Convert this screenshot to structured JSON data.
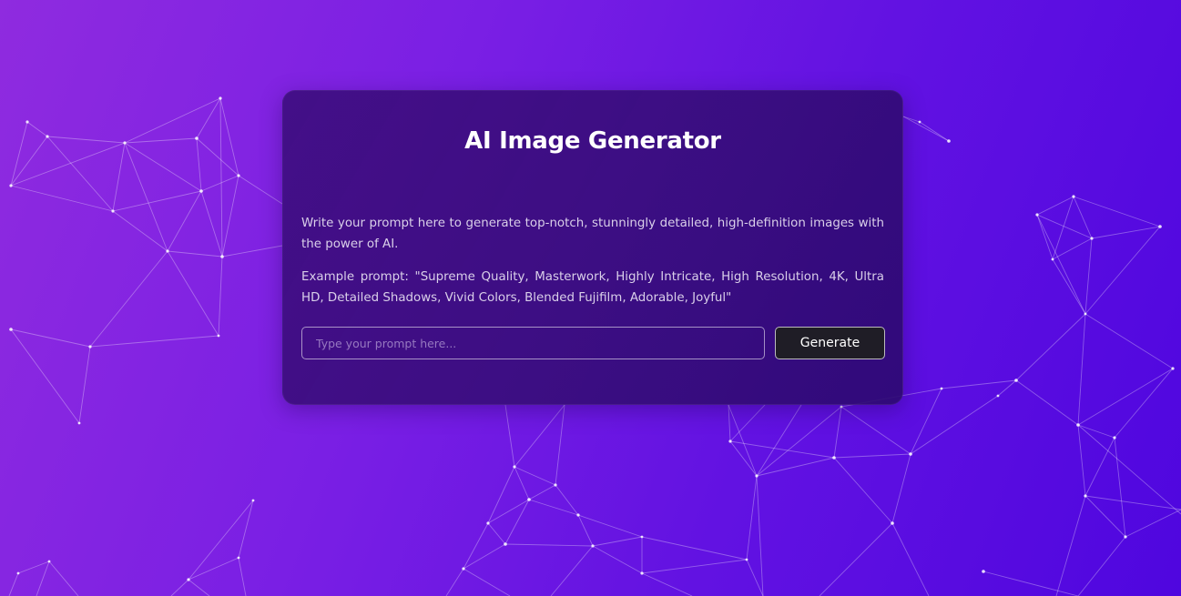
{
  "app": {
    "title": "AI Image Generator"
  },
  "description": {
    "line1": "Write your prompt here to generate top-notch, stunningly detailed, high-definition images with the power of AI.",
    "example": "Example prompt: \"Supreme Quality, Masterwork, Highly Intricate, High Resolution, 4K, Ultra HD, Detailed Shadows, Vivid Colors, Blended Fujifilm, Adorable, Joyful\""
  },
  "prompt": {
    "placeholder": "Type your prompt here...",
    "value": ""
  },
  "actions": {
    "generate_label": "Generate"
  },
  "theme": {
    "gradient_start": "#8f2bdf",
    "gradient_end": "#4f06df",
    "card_background": "#3a0c7a",
    "button_background": "#1f1d26",
    "text_primary": "#ffffff"
  }
}
